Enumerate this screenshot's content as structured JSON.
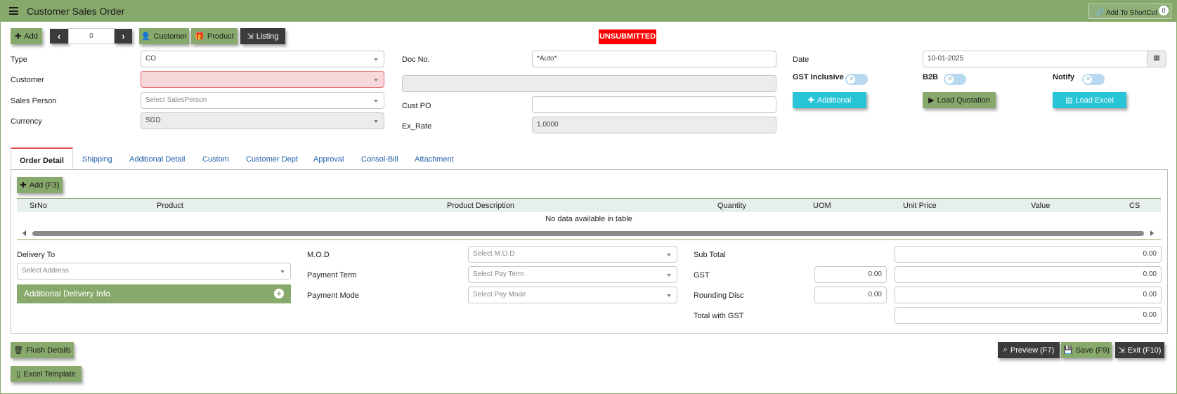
{
  "titlebar": {
    "title": "Customer Sales Order",
    "shortcut_label": "Add To ShortCut",
    "shortcut_count": "0"
  },
  "toolbar": {
    "add": "Add",
    "record_number": "0",
    "customer": "Customer",
    "product": "Product",
    "listing": "Listing"
  },
  "status": "UNSUBMITTED",
  "form": {
    "type_label": "Type",
    "type_value": "CO",
    "customer_label": "Customer",
    "customer_value": "",
    "sales_person_label": "Sales Person",
    "sales_person_placeholder": "Select SalesPerson",
    "currency_label": "Currency",
    "currency_value": "SGD",
    "doc_no_label": "Doc No.",
    "doc_no_value": "*Auto*",
    "cust_po_label": "Cust PO",
    "cust_po_value": "",
    "ex_rate_label": "Ex_Rate",
    "ex_rate_value": "1.0000",
    "date_label": "Date",
    "date_value": "10-01-2025",
    "gst_inclusive_label": "GST Inclusive",
    "b2b_label": "B2B",
    "notify_label": "Notify",
    "additional_button": "Additional",
    "load_quotation_button": "Load Quotation",
    "load_excel_button": "Load Excel"
  },
  "tabs": [
    "Order Detail",
    "Shipping",
    "Additional Detail",
    "Custom",
    "Customer Dept",
    "Approval",
    "Consol-Bill",
    "Attachment"
  ],
  "grid": {
    "add_button": "Add (F3)",
    "columns": [
      "SrNo",
      "Product",
      "Product Description",
      "Quantity",
      "UOM",
      "Unit Price",
      "Value",
      "CS"
    ],
    "empty_text": "No data available in table"
  },
  "delivery": {
    "label": "Delivery To",
    "address_placeholder": "Select Address",
    "additional_info": "Additional Delivery Info"
  },
  "payment": {
    "mod_label": "M.O.D",
    "mod_placeholder": "Select M.O.D",
    "term_label": "Payment Term",
    "term_placeholder": "Select Pay Term",
    "mode_label": "Payment Mode",
    "mode_placeholder": "Select Pay Mode"
  },
  "totals": {
    "subtotal_label": "Sub Total",
    "subtotal_value": "0.00",
    "gst_label": "GST",
    "gst_rate": "0.00",
    "gst_value": "0.00",
    "rounding_label": "Rounding Disc",
    "rounding_rate": "0.00",
    "rounding_value": "0.00",
    "total_label": "Total with GST",
    "total_value": "0.00"
  },
  "footer": {
    "flush": "Flush Details",
    "excel_template": "Excel Template",
    "preview": "Preview (F7)",
    "save": "Save (F9)",
    "exit": "Exit (F10)"
  }
}
